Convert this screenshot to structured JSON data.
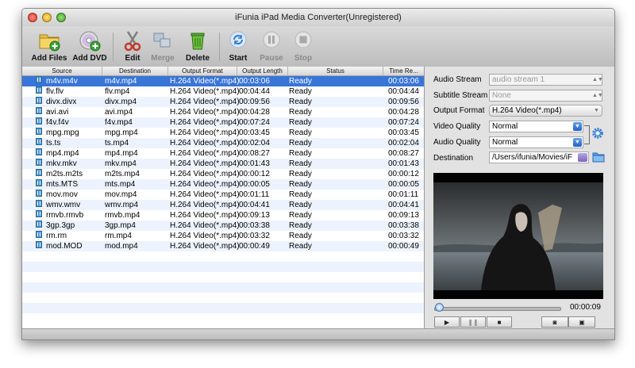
{
  "window": {
    "title": "iFunia iPad Media Converter(Unregistered)"
  },
  "toolbar": {
    "add_files": "Add Files",
    "add_dvd": "Add DVD",
    "edit": "Edit",
    "merge": "Merge",
    "delete": "Delete",
    "start": "Start",
    "pause": "Pause",
    "stop": "Stop"
  },
  "table": {
    "headers": [
      "Source",
      "Destination",
      "Output Format",
      "Output Length",
      "Status",
      "Time Re..."
    ],
    "rows": [
      {
        "source": "m4v.m4v",
        "dest": "m4v.mp4",
        "format": "H.264 Video(*.mp4)",
        "length": "00:03:06",
        "status": "Ready",
        "remaining": "00:03:06"
      },
      {
        "source": "flv.flv",
        "dest": "flv.mp4",
        "format": "H.264 Video(*.mp4)",
        "length": "00:04:44",
        "status": "Ready",
        "remaining": "00:04:44"
      },
      {
        "source": "divx.divx",
        "dest": "divx.mp4",
        "format": "H.264 Video(*.mp4)",
        "length": "00:09:56",
        "status": "Ready",
        "remaining": "00:09:56"
      },
      {
        "source": "avi.avi",
        "dest": "avi.mp4",
        "format": "H.264 Video(*.mp4)",
        "length": "00:04:28",
        "status": "Ready",
        "remaining": "00:04:28"
      },
      {
        "source": "f4v.f4v",
        "dest": "f4v.mp4",
        "format": "H.264 Video(*.mp4)",
        "length": "00:07:24",
        "status": "Ready",
        "remaining": "00:07:24"
      },
      {
        "source": "mpg.mpg",
        "dest": "mpg.mp4",
        "format": "H.264 Video(*.mp4)",
        "length": "00:03:45",
        "status": "Ready",
        "remaining": "00:03:45"
      },
      {
        "source": "ts.ts",
        "dest": "ts.mp4",
        "format": "H.264 Video(*.mp4)",
        "length": "00:02:04",
        "status": "Ready",
        "remaining": "00:02:04"
      },
      {
        "source": "mp4.mp4",
        "dest": "mp4.mp4",
        "format": "H.264 Video(*.mp4)",
        "length": "00:08:27",
        "status": "Ready",
        "remaining": "00:08:27"
      },
      {
        "source": "mkv.mkv",
        "dest": "mkv.mp4",
        "format": "H.264 Video(*.mp4)",
        "length": "00:01:43",
        "status": "Ready",
        "remaining": "00:01:43"
      },
      {
        "source": "m2ts.m2ts",
        "dest": "m2ts.mp4",
        "format": "H.264 Video(*.mp4)",
        "length": "00:00:12",
        "status": "Ready",
        "remaining": "00:00:12"
      },
      {
        "source": "mts.MTS",
        "dest": "mts.mp4",
        "format": "H.264 Video(*.mp4)",
        "length": "00:00:05",
        "status": "Ready",
        "remaining": "00:00:05"
      },
      {
        "source": "mov.mov",
        "dest": "mov.mp4",
        "format": "H.264 Video(*.mp4)",
        "length": "00:01:11",
        "status": "Ready",
        "remaining": "00:01:11"
      },
      {
        "source": "wmv.wmv",
        "dest": "wmv.mp4",
        "format": "H.264 Video(*.mp4)",
        "length": "00:04:41",
        "status": "Ready",
        "remaining": "00:04:41"
      },
      {
        "source": "rmvb.rmvb",
        "dest": "rmvb.mp4",
        "format": "H.264 Video(*.mp4)",
        "length": "00:09:13",
        "status": "Ready",
        "remaining": "00:09:13"
      },
      {
        "source": "3gp.3gp",
        "dest": "3gp.mp4",
        "format": "H.264 Video(*.mp4)",
        "length": "00:03:38",
        "status": "Ready",
        "remaining": "00:03:38"
      },
      {
        "source": "rm.rm",
        "dest": "rm.mp4",
        "format": "H.264 Video(*.mp4)",
        "length": "00:03:32",
        "status": "Ready",
        "remaining": "00:03:32"
      },
      {
        "source": "mod.MOD",
        "dest": "mod.mp4",
        "format": "H.264 Video(*.mp4)",
        "length": "00:00:49",
        "status": "Ready",
        "remaining": "00:00:49"
      }
    ]
  },
  "settings": {
    "audio_stream_label": "Audio Stream",
    "audio_stream_value": "audio stream 1",
    "subtitle_stream_label": "Subtitle Stream",
    "subtitle_stream_value": "None",
    "output_format_label": "Output Format",
    "output_format_value": "H.264 Video(*.mp4)",
    "video_quality_label": "Video Quality",
    "video_quality_value": "Normal",
    "audio_quality_label": "Audio Quality",
    "audio_quality_value": "Normal",
    "destination_label": "Destination",
    "destination_value": "/Users/ifunia/Movies/iF"
  },
  "player": {
    "time": "00:00:09",
    "progress": 0.03
  },
  "icons": {
    "add_files": "folder-plus-icon",
    "add_dvd": "dvd-plus-icon",
    "edit": "scissors-icon",
    "merge": "merge-icon",
    "delete": "trash-icon",
    "start": "refresh-icon",
    "pause": "pause-icon",
    "stop": "stop-icon",
    "settings": "gear-icon",
    "folder": "folder-icon"
  },
  "colors": {
    "selection": "#3875d7",
    "row_alt": "#edf3fe"
  }
}
